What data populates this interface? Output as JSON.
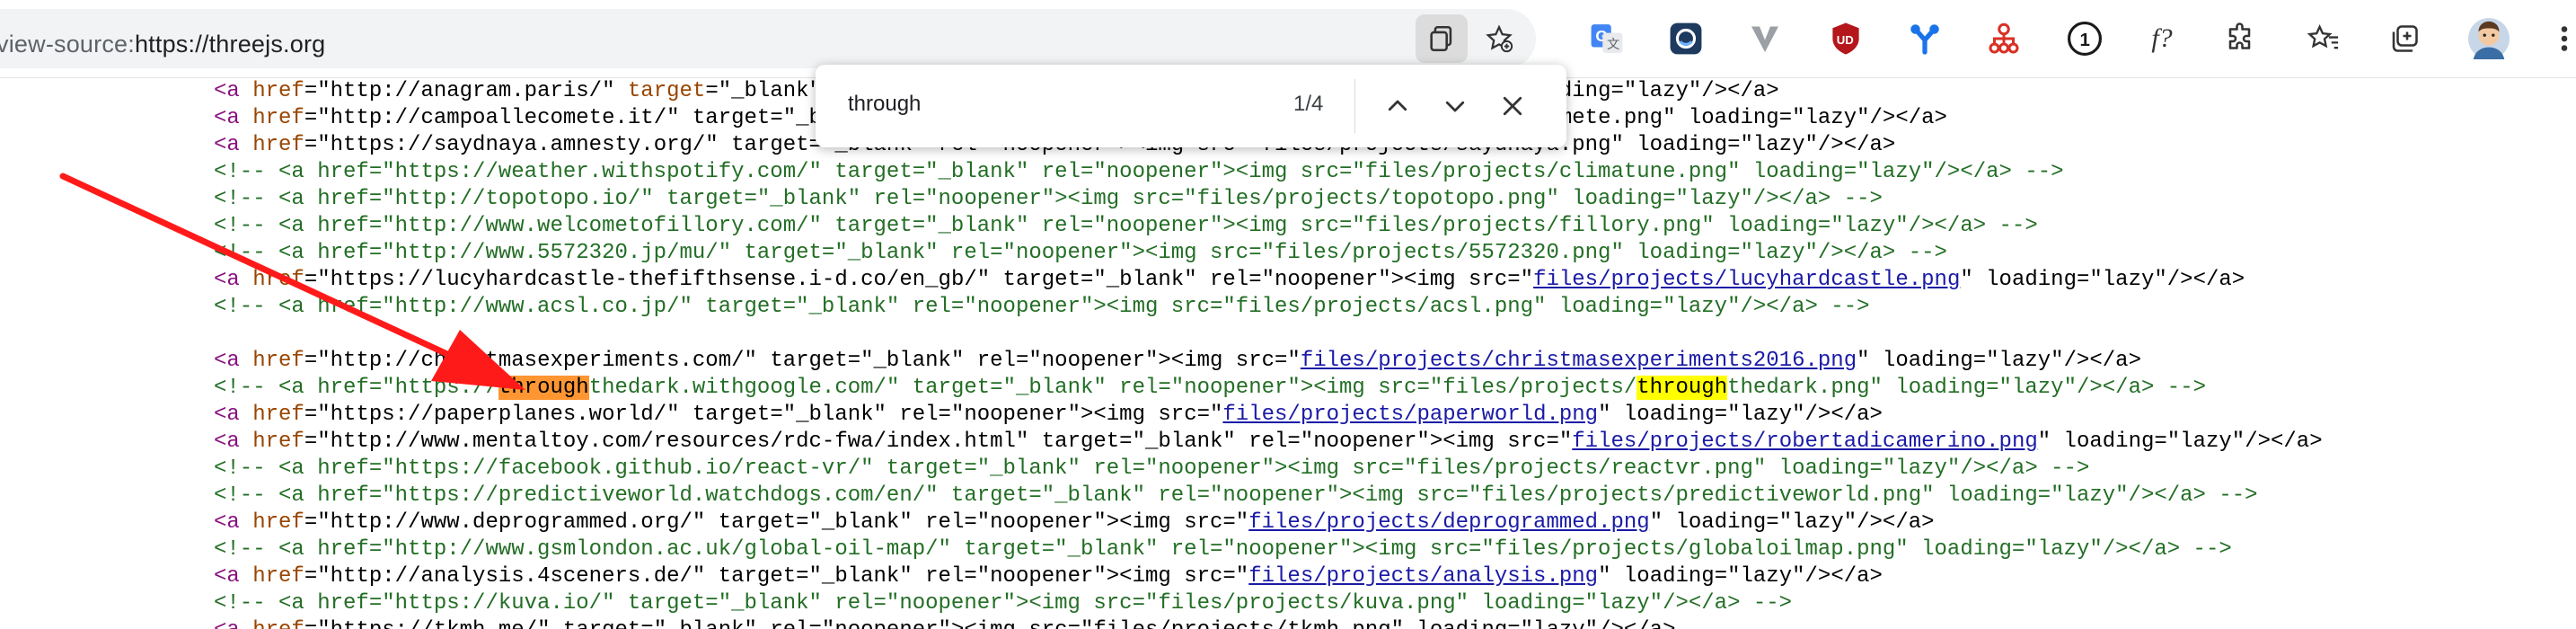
{
  "address_bar": {
    "url_scheme": "view-source:",
    "url_rest": "https://threejs.org"
  },
  "toolbar_icons": [
    "copy-icon",
    "favorite-add-icon",
    "translate-icon",
    "circle-ext-icon",
    "v-ext-icon",
    "shield-ext-icon",
    "y-ext-icon",
    "tree-ext-icon",
    "password-ext-icon",
    "fx-ext-icon",
    "puzzle-icon",
    "favorites-icon",
    "collections-icon",
    "profile-avatar"
  ],
  "toolbar_text": {
    "fx": "f?",
    "password": "1",
    "shield": "UD"
  },
  "find_bar": {
    "query": "through",
    "count": "1/4"
  },
  "source_lines": [
    {
      "parts": [
        [
          "tag",
          "<a "
        ],
        [
          "attr",
          "href"
        ],
        [
          "",
          "=\"http://anagram.paris/\" "
        ],
        [
          "attr",
          "target"
        ],
        [
          "",
          "=\"_blank\" rel=\"noopener\"><img src=\"files/projects/anagram.png\" loading=\"lazy\"/></a>"
        ]
      ]
    },
    {
      "parts": [
        [
          "tag",
          "<a "
        ],
        [
          "attr",
          "href"
        ],
        [
          "",
          "=\"http://campoallecomete.it/\" target=\"_blank\" rel=\"noopener\"><img src=\"files/projects/campoallecomete.png\" loading=\"lazy\"/></a>"
        ]
      ]
    },
    {
      "parts": [
        [
          "tag",
          "<a "
        ],
        [
          "attr",
          "href"
        ],
        [
          "",
          "=\"https://saydnaya.amnesty.org/\" target=\"_blank\" rel=\"noopener\"><img src=\"files/projects/saydnaya.png\" loading=\"lazy\"/></a>"
        ]
      ]
    },
    {
      "parts": [
        [
          "cmt",
          "<!-- <a href=\"https://weather.withspotify.com/\" target=\"_blank\" rel=\"noopener\"><img src=\"files/projects/climatune.png\" loading=\"lazy\"/></a> -->"
        ]
      ]
    },
    {
      "parts": [
        [
          "cmt",
          "<!-- <a href=\"http://topotopo.io/\" target=\"_blank\" rel=\"noopener\"><img src=\"files/projects/topotopo.png\" loading=\"lazy\"/></a> -->"
        ]
      ]
    },
    {
      "parts": [
        [
          "cmt",
          "<!-- <a href=\"http://www.welcometofillory.com/\" target=\"_blank\" rel=\"noopener\"><img src=\"files/projects/fillory.png\" loading=\"lazy\"/></a> -->"
        ]
      ]
    },
    {
      "parts": [
        [
          "cmt",
          "<!-- <a href=\"http://www.5572320.jp/mu/\" target=\"_blank\" rel=\"noopener\"><img src=\"files/projects/5572320.png\" loading=\"lazy\"/></a> -->"
        ]
      ]
    },
    {
      "parts": [
        [
          "tag",
          "<a "
        ],
        [
          "attr",
          "href"
        ],
        [
          "",
          "=\"https://lucyhardcastle-thefifthsense.i-d.co/en_gb/\" target=\"_blank\" rel=\"noopener\"><img src=\""
        ],
        [
          "link",
          "files/projects/lucyhardcastle.png"
        ],
        [
          "",
          "\" loading=\"lazy\"/></a>"
        ]
      ]
    },
    {
      "parts": [
        [
          "cmt",
          "<!-- <a href=\"http://www.acsl.co.jp/\" target=\"_blank\" rel=\"noopener\"><img src=\"files/projects/acsl.png\" loading=\"lazy\"/></a> -->"
        ]
      ]
    },
    {
      "parts": [
        [
          "",
          ""
        ]
      ]
    },
    {
      "parts": [
        [
          "tag",
          "<a "
        ],
        [
          "attr",
          "href"
        ],
        [
          "",
          "=\"http://christmasexperiments.com/\" target=\"_blank\" rel=\"noopener\"><img src=\""
        ],
        [
          "link",
          "files/projects/christmasexperiments2016.png"
        ],
        [
          "",
          "\" loading=\"lazy\"/></a>"
        ]
      ]
    },
    {
      "parts": [
        [
          "cmt",
          "<!-- <a href=\"https://"
        ],
        [
          "hl-current",
          "through"
        ],
        [
          "cmt",
          "thedark.withgoogle.com/\" target=\"_blank\" rel=\"noopener\"><img src=\"files/projects/"
        ],
        [
          "hl",
          "through"
        ],
        [
          "cmt",
          "thedark.png\" loading=\"lazy\"/></a> -->"
        ]
      ]
    },
    {
      "parts": [
        [
          "tag",
          "<a "
        ],
        [
          "attr",
          "href"
        ],
        [
          "",
          "=\"https://paperplanes.world/\" target=\"_blank\" rel=\"noopener\"><img src=\""
        ],
        [
          "link",
          "files/projects/paperworld.png"
        ],
        [
          "",
          "\" loading=\"lazy\"/></a>"
        ]
      ]
    },
    {
      "parts": [
        [
          "tag",
          "<a "
        ],
        [
          "attr",
          "href"
        ],
        [
          "",
          "=\"http://www.mentaltoy.com/resources/rdc-fwa/index.html\" target=\"_blank\" rel=\"noopener\"><img src=\""
        ],
        [
          "link",
          "files/projects/robertadicamerino.png"
        ],
        [
          "",
          "\" loading=\"lazy\"/></a>"
        ]
      ]
    },
    {
      "parts": [
        [
          "cmt",
          "<!-- <a href=\"https://facebook.github.io/react-vr/\" target=\"_blank\" rel=\"noopener\"><img src=\"files/projects/reactvr.png\" loading=\"lazy\"/></a> -->"
        ]
      ]
    },
    {
      "parts": [
        [
          "cmt",
          "<!-- <a href=\"https://predictiveworld.watchdogs.com/en/\" target=\"_blank\" rel=\"noopener\"><img src=\"files/projects/predictiveworld.png\" loading=\"lazy\"/></a> -->"
        ]
      ]
    },
    {
      "parts": [
        [
          "tag",
          "<a "
        ],
        [
          "attr",
          "href"
        ],
        [
          "",
          "=\"http://www.deprogrammed.org/\" target=\"_blank\" rel=\"noopener\"><img src=\""
        ],
        [
          "link",
          "files/projects/deprogrammed.png"
        ],
        [
          "",
          "\" loading=\"lazy\"/></a>"
        ]
      ]
    },
    {
      "parts": [
        [
          "cmt",
          "<!-- <a href=\"http://www.gsmlondon.ac.uk/global-oil-map/\" target=\"_blank\" rel=\"noopener\"><img src=\"files/projects/globaloilmap.png\" loading=\"lazy\"/></a> -->"
        ]
      ]
    },
    {
      "parts": [
        [
          "tag",
          "<a "
        ],
        [
          "attr",
          "href"
        ],
        [
          "",
          "=\"http://analysis.4sceners.de/\" target=\"_blank\" rel=\"noopener\"><img src=\""
        ],
        [
          "link",
          "files/projects/analysis.png"
        ],
        [
          "",
          "\" loading=\"lazy\"/></a>"
        ]
      ]
    },
    {
      "parts": [
        [
          "cmt",
          "<!-- <a href=\"https://kuva.io/\" target=\"_blank\" rel=\"noopener\"><img src=\"files/projects/kuva.png\" loading=\"lazy\"/></a> -->"
        ]
      ]
    },
    {
      "parts": [
        [
          "tag",
          "<a "
        ],
        [
          "attr",
          "href"
        ],
        [
          "",
          "=\"https://tkmh.me/\" target=\"_blank\" rel=\"noopener\"><img src=\"files/projects/tkmh.png\" loading=\"lazy\"/></a>"
        ]
      ]
    }
  ],
  "colors": {
    "tag": "#881280",
    "attribute": "#994500",
    "value": "#1a1aa6",
    "comment": "#236e25",
    "current_match": "#ff9632",
    "match": "#ffff00",
    "annotation_arrow": "#ff1a1a"
  }
}
